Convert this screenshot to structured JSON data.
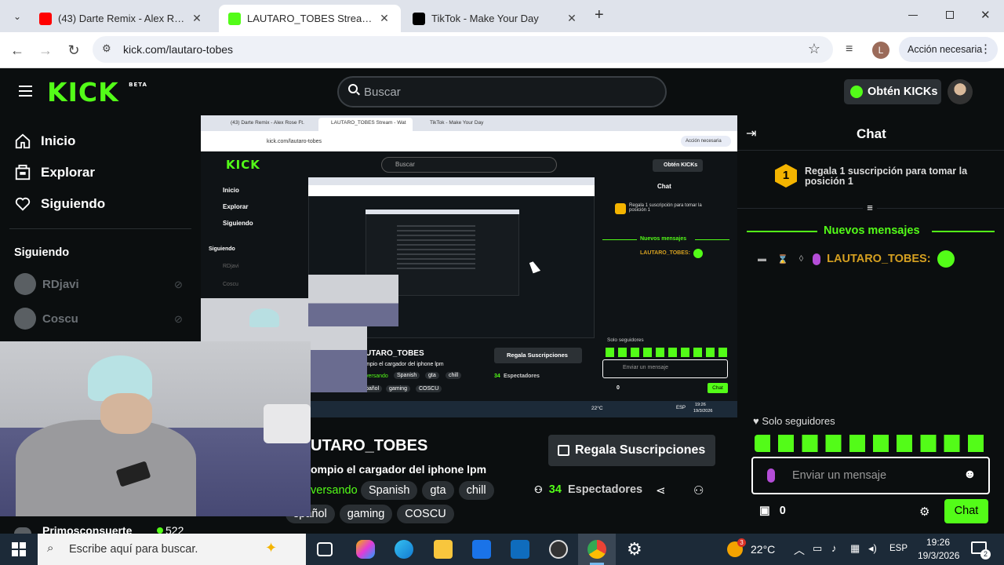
{
  "browser": {
    "tabs": [
      {
        "title": "(43) Darte Remix - Alex Rose Ft.",
        "active": false,
        "favicon_color": "#ff0000"
      },
      {
        "title": "LAUTARO_TOBES Stream - Watch",
        "active": true,
        "favicon_color": "#53fc18"
      },
      {
        "title": "TikTok - Make Your Day",
        "active": false,
        "favicon_color": "#000000"
      }
    ],
    "tab_close_glyph": "✕",
    "new_tab_glyph": "+",
    "url": "kick.com/lautaro-tobes",
    "profile_initial": "L",
    "action_button": "Acción necesaria"
  },
  "kick": {
    "logo_text": "KICK",
    "logo_badge": "BETA",
    "search_placeholder": "Buscar",
    "get_kicks_label": "Obtén KICKs",
    "accent_color": "#53fc18",
    "nav": [
      {
        "label": "Inicio",
        "icon": "home-icon"
      },
      {
        "label": "Explorar",
        "icon": "compass-icon"
      },
      {
        "label": "Siguiendo",
        "icon": "heart-icon"
      }
    ],
    "following_heading": "Siguiendo",
    "following": [
      {
        "name": "RDjavi"
      },
      {
        "name": "Coscu"
      }
    ],
    "channel": {
      "name": "UTARO_TOBES",
      "title": "ompio el cargador del iphone lpm",
      "category_fragment": "versando",
      "tags_row1": [
        "Spanish",
        "gta",
        "chill"
      ],
      "tags_row2": [
        "spañol",
        "gaming",
        "COSCU"
      ],
      "subscribe_button": "Regala Suscripciones",
      "viewers_count": "34",
      "viewers_label": "Espectadores"
    },
    "under_webcam": {
      "name": "Primosconsuerte",
      "count": "522"
    }
  },
  "chat": {
    "header": "Chat",
    "gift_rank": "1",
    "gift_prompt": "Regala 1 suscripción para tomar la posición 1",
    "new_messages_label": "Nuevos mensajes",
    "messages": [
      {
        "user": "LAUTARO_TOBES:",
        "emote": "green-emote"
      }
    ],
    "followers_only": "Solo seguidores",
    "input_placeholder": "Enviar un mensaje",
    "points_count": "0",
    "send_button": "Chat"
  },
  "nested_capture": {
    "tabs": [
      "(43) Darte Remix - Alex Rose Ft.",
      "LAUTARO_TOBES Stream - Wat",
      "TikTok - Make Your Day"
    ],
    "url": "kick.com/lautaro-tobes",
    "action": "Acción necesaria",
    "search": "Buscar",
    "kicks": "Obtén KICKs",
    "nav": [
      "Inicio",
      "Explorar",
      "Siguiendo"
    ],
    "following_heading": "Siguiendo",
    "following": [
      "RDjavi",
      "Coscu"
    ],
    "chat_header": "Chat",
    "gift_prompt": "Regala 1 suscripción para tomar la posición 1",
    "new_messages": "Nuevos mensajes",
    "message_user": "LAUTARO_TOBES:",
    "channel_name": "UTARO_TOBES",
    "channel_title": "mpio el cargador del iphone lpm",
    "category": "versando",
    "tags": [
      "Spanish",
      "gta",
      "chill"
    ],
    "tags2": [
      "pañol",
      "gaming",
      "COSCU"
    ],
    "subscribe": "Regala Suscripciones",
    "viewers_count": "34",
    "viewers_label": "Espectadores",
    "followers_only": "Solo seguidores",
    "input": "Enviar un mensaje",
    "points": "0",
    "send": "Chat",
    "temp": "22°C",
    "lang": "ESP",
    "time": "19:26",
    "date": "19/3/2026"
  },
  "taskbar": {
    "search_placeholder": "Escribe aquí para buscar.",
    "weather_badge": "3",
    "temperature": "22°C",
    "language": "ESP",
    "time": "19:26",
    "date": "19/3/2026",
    "notifications": "2"
  }
}
